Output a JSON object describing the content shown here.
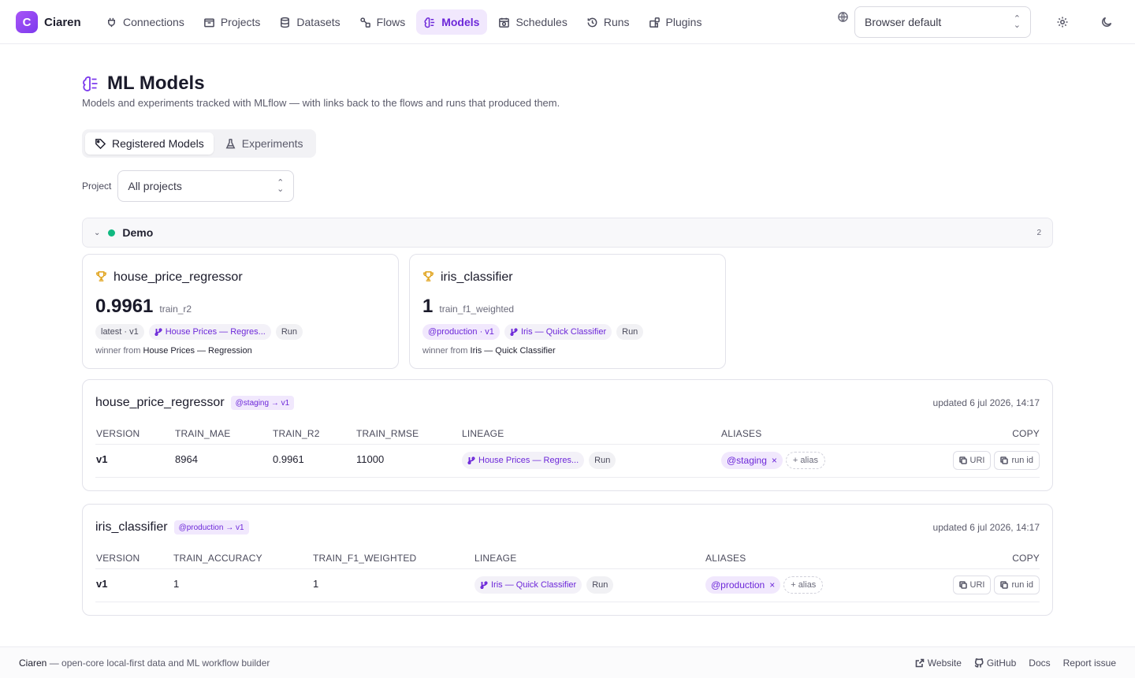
{
  "app": {
    "logo_letter": "C",
    "name": "Ciaren"
  },
  "nav": [
    {
      "label": "Connections",
      "icon": "plug-icon"
    },
    {
      "label": "Projects",
      "icon": "folder-icon"
    },
    {
      "label": "Datasets",
      "icon": "database-icon"
    },
    {
      "label": "Flows",
      "icon": "flow-icon"
    },
    {
      "label": "Models",
      "icon": "brain-icon",
      "active": true
    },
    {
      "label": "Schedules",
      "icon": "calendar-icon"
    },
    {
      "label": "Runs",
      "icon": "history-icon"
    },
    {
      "label": "Plugins",
      "icon": "puzzle-icon"
    }
  ],
  "language_select": {
    "value": "Browser default"
  },
  "page": {
    "title": "ML Models",
    "subtitle": "Models and experiments tracked with MLflow — with links back to the flows and runs that produced them."
  },
  "tabs": [
    {
      "label": "Registered Models",
      "icon": "tag-icon",
      "active": true
    },
    {
      "label": "Experiments",
      "icon": "flask-icon"
    }
  ],
  "filter": {
    "label": "Project",
    "value": "All projects"
  },
  "group": {
    "name": "Demo",
    "count": "2",
    "status_color": "#10b981"
  },
  "champions": [
    {
      "name": "house_price_regressor",
      "metric_value": "0.9961",
      "metric_name": "train_r2",
      "version_chip": "latest · v1",
      "flow_chip": "House Prices — Regres...",
      "run_chip": "Run",
      "winner_prefix": "winner from",
      "winner_flow": "House Prices — Regression"
    },
    {
      "name": "iris_classifier",
      "metric_value": "1",
      "metric_name": "train_f1_weighted",
      "version_chip": "@production · v1",
      "flow_chip": "Iris — Quick Classifier",
      "run_chip": "Run",
      "winner_prefix": "winner from",
      "winner_flow": "Iris — Quick Classifier"
    }
  ],
  "models": [
    {
      "name": "house_price_regressor",
      "badge": "@staging → v1",
      "updated": "updated 6 jul 2026, 14:17",
      "headers": [
        "VERSION",
        "TRAIN_MAE",
        "TRAIN_R2",
        "TRAIN_RMSE",
        "LINEAGE",
        "ALIASES",
        "COPY"
      ],
      "row": {
        "version": "v1",
        "metrics": [
          "8964",
          "0.9961",
          "11000"
        ],
        "flow": "House Prices — Regres...",
        "run": "Run",
        "alias": "@staging",
        "add_alias": "alias",
        "copy_uri": "URI",
        "copy_run": "run id"
      }
    },
    {
      "name": "iris_classifier",
      "badge": "@production → v1",
      "updated": "updated 6 jul 2026, 14:17",
      "headers": [
        "VERSION",
        "TRAIN_ACCURACY",
        "TRAIN_F1_WEIGHTED",
        "LINEAGE",
        "ALIASES",
        "COPY"
      ],
      "row": {
        "version": "v1",
        "metrics": [
          "1",
          "1"
        ],
        "flow": "Iris — Quick Classifier",
        "run": "Run",
        "alias": "@production",
        "add_alias": "alias",
        "copy_uri": "URI",
        "copy_run": "run id"
      }
    }
  ],
  "footer": {
    "brand": "Ciaren",
    "tagline": "— open-core local-first data and ML workflow builder",
    "links": [
      "Website",
      "GitHub",
      "Docs",
      "Report issue"
    ]
  }
}
